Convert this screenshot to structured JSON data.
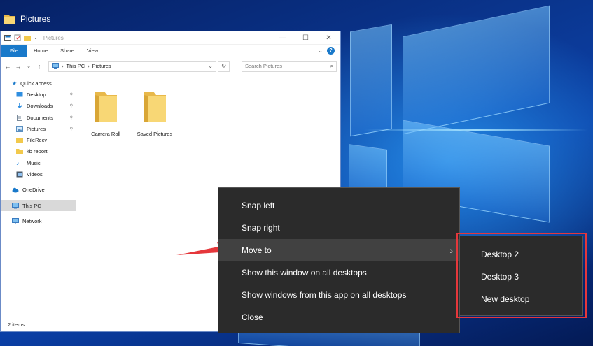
{
  "desktop": {
    "window_title": "Pictures"
  },
  "explorer": {
    "title": "Pictures",
    "window_controls": {
      "minimize": "—",
      "maximize": "☐",
      "close": "✕"
    },
    "ribbon": {
      "tabs": [
        "File",
        "Home",
        "Share",
        "View"
      ],
      "expand": "⌄",
      "help": "?"
    },
    "nav_buttons": {
      "back": "←",
      "forward": "→",
      "recent": "⌄",
      "up": "↑"
    },
    "address": {
      "segments": [
        "This PC",
        "Pictures"
      ],
      "separator": "›",
      "dropdown": "⌄",
      "refresh": "↻"
    },
    "search": {
      "placeholder": "Search Pictures",
      "icon": "search-icon"
    },
    "nav_pane": {
      "quick_access": "Quick access",
      "quick_items": [
        {
          "label": "Desktop",
          "icon": "desktop-icon",
          "pinned": true
        },
        {
          "label": "Downloads",
          "icon": "download-icon",
          "pinned": true
        },
        {
          "label": "Documents",
          "icon": "documents-icon",
          "pinned": true
        },
        {
          "label": "Pictures",
          "icon": "pictures-icon",
          "pinned": true
        },
        {
          "label": "FileRecv",
          "icon": "folder-icon",
          "pinned": false
        },
        {
          "label": "kb report",
          "icon": "folder-icon",
          "pinned": false
        },
        {
          "label": "Music",
          "icon": "music-icon",
          "pinned": false
        },
        {
          "label": "Videos",
          "icon": "videos-icon",
          "pinned": false
        }
      ],
      "onedrive": "OneDrive",
      "this_pc": "This PC",
      "network": "Network",
      "pin_glyph": "📌"
    },
    "files": [
      {
        "name": "Camera Roll",
        "icon": "folder-icon"
      },
      {
        "name": "Saved Pictures",
        "icon": "folder-icon"
      }
    ],
    "status": "2 items"
  },
  "context_menu": {
    "items": [
      "Snap left",
      "Snap right",
      "Move to",
      "Show this window on all desktops",
      "Show windows from this app on all desktops",
      "Close"
    ],
    "hovered_index": 2,
    "submenu_chevron": "›"
  },
  "submenu": {
    "items": [
      "Desktop 2",
      "Desktop 3",
      "New desktop"
    ]
  },
  "colors": {
    "accent": "#1979ca",
    "menu_bg": "#2b2b2b",
    "menu_hover": "#414141",
    "annotation_red": "#e5373b",
    "folder_yellow": "#f8d775"
  }
}
